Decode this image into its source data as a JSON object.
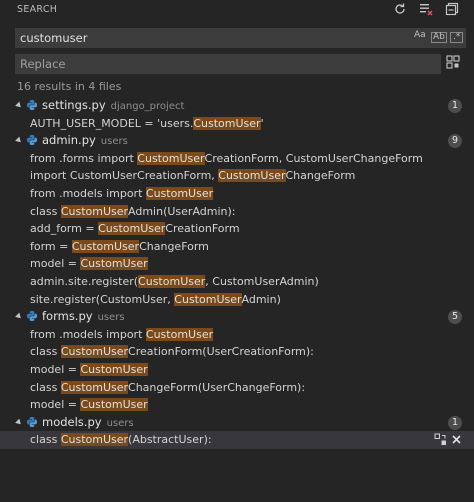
{
  "header": {
    "title": "SEARCH",
    "icons": [
      "refresh-icon",
      "clear-results-icon",
      "collapse-all-icon"
    ]
  },
  "search": {
    "value": "customuser",
    "match_case_label": "Aa",
    "whole_word_label": "Ab",
    "regex_label": ".*"
  },
  "replace": {
    "placeholder": "Replace"
  },
  "results_summary": "16 results in 4 files",
  "files": [
    {
      "name": "settings.py",
      "path": "django_project",
      "count": "1",
      "matches": [
        {
          "pre": "AUTH_USER_MODEL = 'users.",
          "hit": "CustomUser",
          "post": "'"
        }
      ]
    },
    {
      "name": "admin.py",
      "path": "users",
      "count": "9",
      "matches": [
        {
          "pre": "from .forms import ",
          "hit": "CustomUser",
          "post": "CreationForm, CustomUserChangeForm"
        },
        {
          "pre": "import CustomUserCreationForm, ",
          "hit": "CustomUser",
          "post": "ChangeForm"
        },
        {
          "pre": "from .models import ",
          "hit": "CustomUser",
          "post": ""
        },
        {
          "pre": "class ",
          "hit": "CustomUser",
          "post": "Admin(UserAdmin):"
        },
        {
          "pre": "add_form = ",
          "hit": "CustomUser",
          "post": "CreationForm"
        },
        {
          "pre": "form = ",
          "hit": "CustomUser",
          "post": "ChangeForm"
        },
        {
          "pre": "model = ",
          "hit": "CustomUser",
          "post": ""
        },
        {
          "pre": "admin.site.register(",
          "hit": "CustomUser",
          "post": ", CustomUserAdmin)"
        },
        {
          "pre": "site.register(CustomUser, ",
          "hit": "CustomUser",
          "post": "Admin)"
        }
      ]
    },
    {
      "name": "forms.py",
      "path": "users",
      "count": "5",
      "matches": [
        {
          "pre": "from .models import ",
          "hit": "CustomUser",
          "post": ""
        },
        {
          "pre": "class ",
          "hit": "CustomUser",
          "post": "CreationForm(UserCreationForm):"
        },
        {
          "pre": "model = ",
          "hit": "CustomUser",
          "post": ""
        },
        {
          "pre": "class ",
          "hit": "CustomUser",
          "post": "ChangeForm(UserChangeForm):"
        },
        {
          "pre": "model = ",
          "hit": "CustomUser",
          "post": ""
        }
      ]
    },
    {
      "name": "models.py",
      "path": "users",
      "count": "1",
      "matches": [
        {
          "pre": "class ",
          "hit": "CustomUser",
          "post": "(AbstractUser):"
        }
      ]
    }
  ],
  "colors": {
    "background": "#252526",
    "input_background": "#3c3c3c",
    "match_highlight": "#7a4a1a",
    "python_icon_blue": "#3a7bbf",
    "selected_row": "#37373d"
  }
}
